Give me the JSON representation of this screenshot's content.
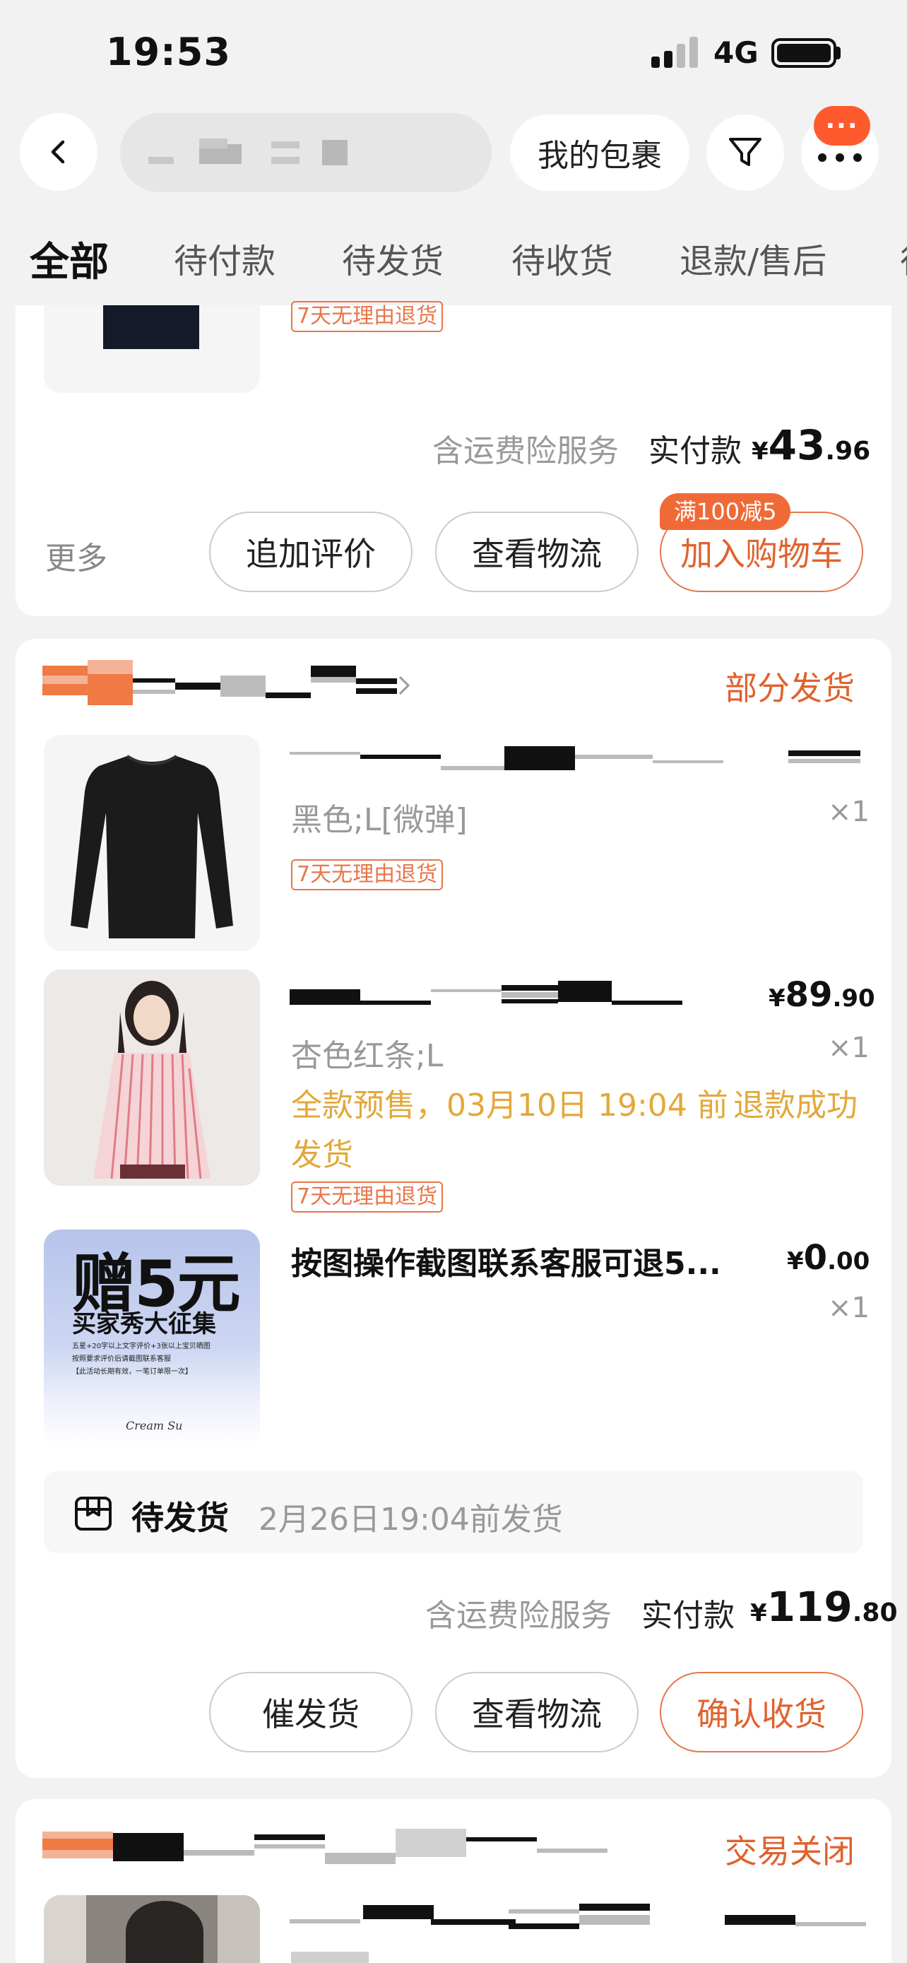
{
  "status_bar": {
    "time": "19:53",
    "network": "4G"
  },
  "header": {
    "my_packages": "我的包裹",
    "badge_text": "···"
  },
  "tabs": [
    {
      "label": "全部",
      "active": true
    },
    {
      "label": "待付款",
      "active": false
    },
    {
      "label": "待发货",
      "active": false
    },
    {
      "label": "待收货",
      "active": false
    },
    {
      "label": "退款/售后",
      "active": false
    },
    {
      "label": "待",
      "active": false
    }
  ],
  "order1": {
    "return_tag": "7天无理由退货",
    "service_text": "含运费险服务",
    "paid_label": "实付款",
    "currency": "¥",
    "total_int": "43",
    "total_dec": ".96",
    "more_label": "更多",
    "promo_badge": "满100减5",
    "buttons": [
      "追加评价",
      "查看物流",
      "加入购物车"
    ]
  },
  "order2": {
    "status": "部分发货",
    "items": [
      {
        "variant": "黑色;L[微弹]",
        "qty": "×1",
        "return_tag": "7天无理由退货"
      },
      {
        "price_currency": "¥",
        "price_int": "89",
        "price_dec": ".90",
        "variant": "杏色红条;L",
        "qty": "×1",
        "presale": "全款预售，03月10日 19:04 前发货",
        "refund": "退款成功",
        "return_tag": "7天无理由退货"
      },
      {
        "title": "按图操作截图联系客服可退5...",
        "price_currency": "¥",
        "price_int": "0",
        "price_dec": ".00",
        "qty": "×1",
        "gift_image": {
          "big": "赠5元",
          "sub": "买家秀大征集",
          "line1": "五星+20字以上文字评价+3张以上宝贝晒图",
          "line2": "按照要求评价后请截图联系客服",
          "line3": "【此活动长期有效，一笔订单限一次】",
          "footer": "Cream Su"
        }
      }
    ],
    "shipping": {
      "status": "待发货",
      "deadline": "2月26日19:04前发货"
    },
    "service_text": "含运费险服务",
    "paid_label": "实付款",
    "currency": "¥",
    "total_int": "119",
    "total_dec": ".80",
    "buttons": [
      "催发货",
      "查看物流",
      "确认收货"
    ]
  },
  "order3": {
    "status": "交易关闭"
  },
  "colors": {
    "accent": "#e0622f",
    "presale": "#e3a83a",
    "background": "#f2f2f2"
  },
  "icons": [
    "back-arrow-icon",
    "filter-icon",
    "more-dots-icon",
    "package-icon",
    "chevron-right-icon"
  ]
}
